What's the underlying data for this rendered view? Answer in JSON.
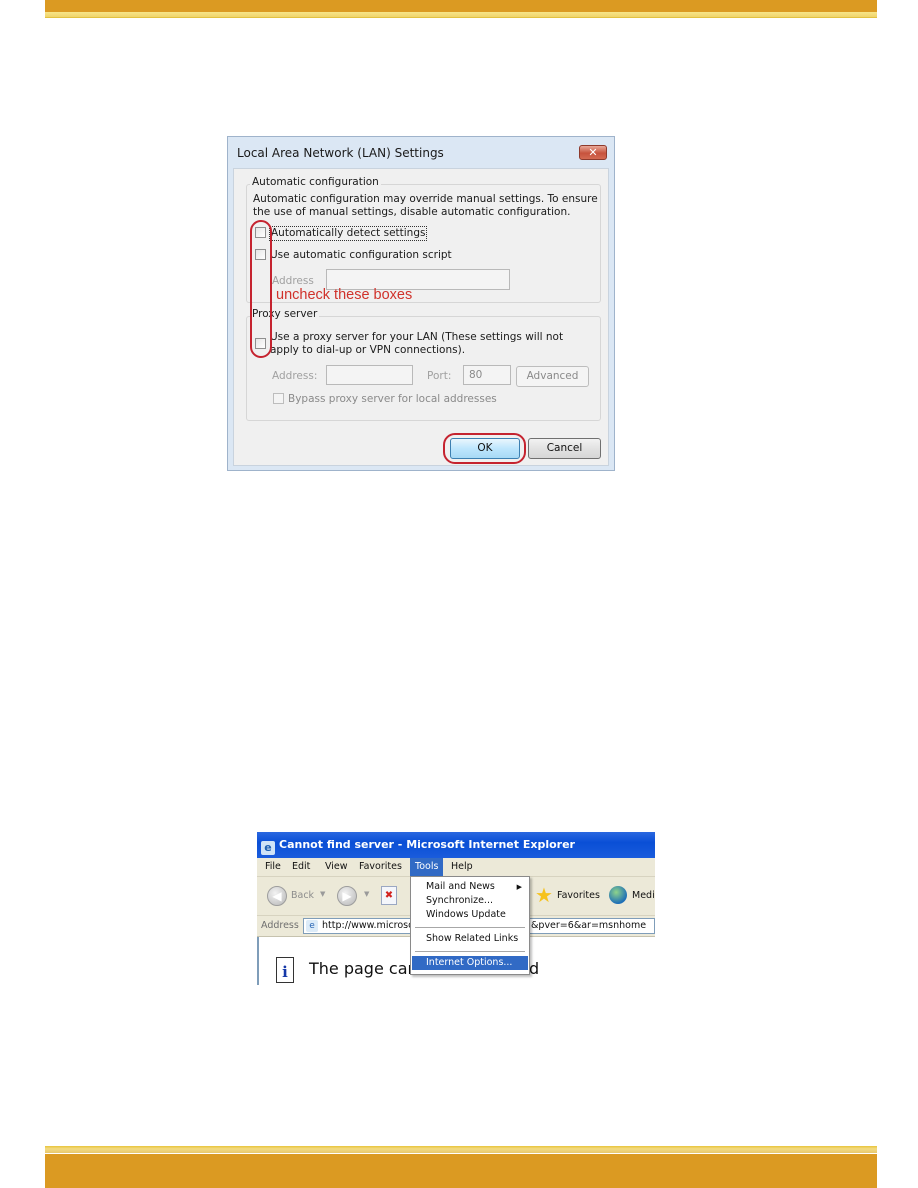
{
  "lan_dialog": {
    "title": "Local Area Network (LAN) Settings",
    "close_glyph": "✕",
    "auto_config": {
      "legend": "Automatic configuration",
      "description": "Automatic configuration may override manual settings.  To ensure the use of manual settings, disable automatic configuration.",
      "detect_label": "Automatically detect settings",
      "detect_checked": false,
      "script_label": "Use automatic configuration script",
      "script_checked": false,
      "address_label": "Address",
      "address_value": ""
    },
    "proxy": {
      "legend": "Proxy server",
      "use_proxy_label": "Use a proxy server for your LAN (These settings will not apply to dial-up or VPN connections).",
      "use_proxy_checked": false,
      "address_label": "Address:",
      "address_value": "",
      "port_label": "Port:",
      "port_value": "80",
      "advanced_label": "Advanced",
      "bypass_label": "Bypass proxy server for local addresses",
      "bypass_checked": false
    },
    "ok_label": "OK",
    "cancel_label": "Cancel",
    "annotation": "uncheck these boxes"
  },
  "ie_window": {
    "title": "Cannot find server - Microsoft Internet Explorer",
    "menu": [
      "File",
      "Edit",
      "View",
      "Favorites",
      "Tools",
      "Help"
    ],
    "active_menu": "Tools",
    "toolbar": {
      "back_label": "Back",
      "favorites_label": "Favorites",
      "media_label": "Medi"
    },
    "address_caption": "Address",
    "address_url_visible_left": "http://www.microso",
    "address_url_visible_right": "&pver=6&ar=msnhome",
    "page_heading_left": "The page can",
    "page_heading_right": "d",
    "tools_menu": {
      "items": [
        "Mail and News",
        "Synchronize...",
        "Windows Update",
        "Show Related Links",
        "Internet Options..."
      ],
      "highlighted": "Internet Options...",
      "submenu_arrow": "▶"
    }
  }
}
